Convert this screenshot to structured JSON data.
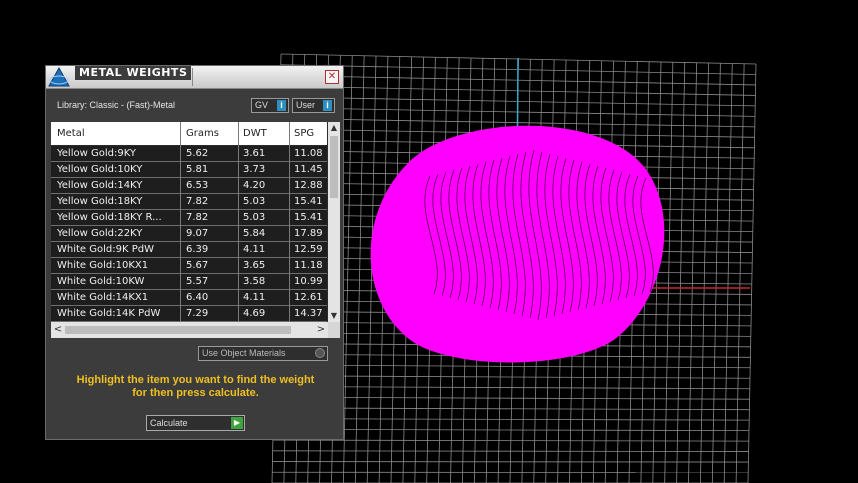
{
  "dialog": {
    "title": "METAL WEIGHTS",
    "close_glyph": "✕",
    "library_label": "Library: Classic - (Fast)-Metal",
    "gv_button": "GV",
    "user_button": "User",
    "info_glyph": "i"
  },
  "table": {
    "columns": [
      "Metal",
      "Grams",
      "DWT",
      "SPG"
    ],
    "rows": [
      [
        "Yellow Gold:9KY",
        "5.62",
        "3.61",
        "11.08"
      ],
      [
        "Yellow Gold:10KY",
        "5.81",
        "3.73",
        "11.45"
      ],
      [
        "Yellow Gold:14KY",
        "6.53",
        "4.20",
        "12.88"
      ],
      [
        "Yellow Gold:18KY",
        "7.82",
        "5.03",
        "15.41"
      ],
      [
        "Yellow Gold:18KY R...",
        "7.82",
        "5.03",
        "15.41"
      ],
      [
        "Yellow Gold:22KY",
        "9.07",
        "5.84",
        "17.89"
      ],
      [
        "White Gold:9K PdW",
        "6.39",
        "4.11",
        "12.59"
      ],
      [
        "White Gold:10KX1",
        "5.67",
        "3.65",
        "11.18"
      ],
      [
        "White Gold:10KW",
        "5.57",
        "3.58",
        "10.99"
      ],
      [
        "White Gold:14KX1",
        "6.40",
        "4.11",
        "12.61"
      ],
      [
        "White Gold:14K PdW",
        "7.29",
        "4.69",
        "14.37"
      ]
    ],
    "scroll_up": "▲",
    "scroll_down": "▼",
    "scroll_left": "<",
    "scroll_right": ">"
  },
  "use_object_materials": "Use Object Materials",
  "hint_line1": "Highlight the item you want to find the weight",
  "hint_line2": "for then press calculate.",
  "calculate_label": "Calculate",
  "calculate_glyph": "▶",
  "colors": {
    "object": "#ff00ff",
    "grid": "#8a8a8a",
    "axis_y": "#3aa6c8",
    "axis_x": "#c82828",
    "hint": "#f0c020"
  }
}
